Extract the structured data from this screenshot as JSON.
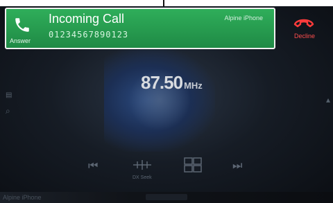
{
  "incoming_call": {
    "title": "Incoming Call",
    "caller_number": "01234567890123",
    "device_name": "Alpine iPhone",
    "answer_label": "Answer",
    "decline_label": "Decline",
    "banner_color": "#2aa655",
    "decline_color": "#ff3b3b"
  },
  "radio": {
    "frequency": "87.50",
    "unit": "MHz"
  },
  "controls": {
    "seek_label": "DX Seek"
  },
  "source": {
    "name": "Alpine iPhone"
  },
  "icons": [
    "phone-icon",
    "hang-up-icon",
    "previous-track-icon",
    "dx-seek-icon",
    "preset-grid-icon",
    "next-track-icon"
  ]
}
